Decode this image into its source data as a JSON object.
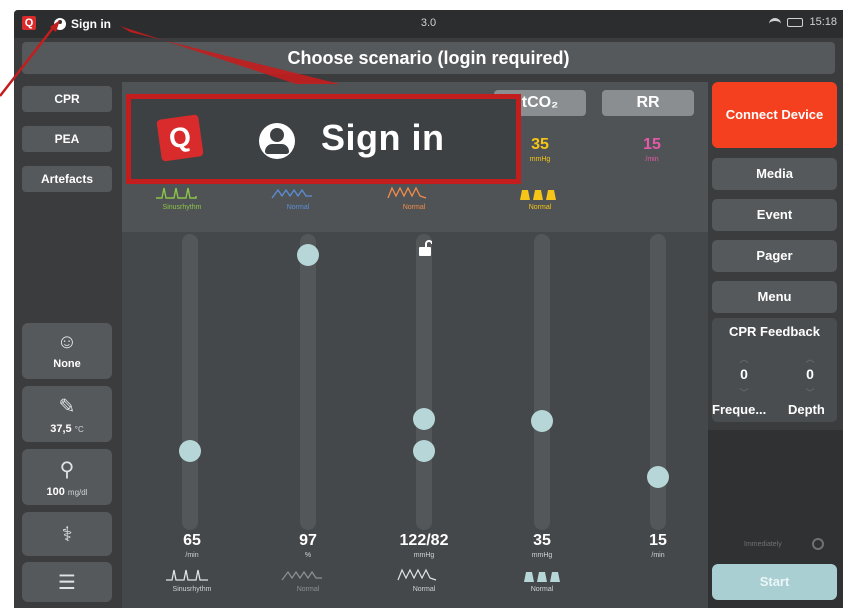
{
  "statusbar": {
    "logo_letter": "Q",
    "signin_label": "Sign in",
    "version": "3.0",
    "time": "15:18"
  },
  "title": "Choose scenario (login required)",
  "sidebar": {
    "buttons": [
      {
        "label": "CPR"
      },
      {
        "label": "PEA"
      },
      {
        "label": "Artefacts"
      }
    ],
    "tiles": [
      {
        "icon": "person-icon",
        "label": "None",
        "sub": ""
      },
      {
        "icon": "thermometer-icon",
        "label": "37,5",
        "sub": "°C"
      },
      {
        "icon": "glucose-icon",
        "label": "100",
        "sub": "mg/dl"
      },
      {
        "icon": "stethoscope-icon",
        "label": "",
        "sub": ""
      },
      {
        "icon": "settings-icon",
        "label": "",
        "sub": ""
      }
    ]
  },
  "header_columns": [
    {
      "label": "",
      "value": "",
      "unit": "",
      "wave_label": "Sinusrhythm",
      "wave_color": "#8bc34a"
    },
    {
      "label": "",
      "value": "",
      "unit": "",
      "wave_label": "Normal",
      "wave_color": "#5b8fd6"
    },
    {
      "label": "",
      "value": "",
      "unit": "",
      "wave_label": "Normal",
      "wave_color": "#f28c4a"
    },
    {
      "label": "tCO₂",
      "value": "35",
      "unit": "mmHg",
      "wave_label": "Normal",
      "wave_color": "#f5c518"
    },
    {
      "label": "RR",
      "value": "15",
      "unit": "/min",
      "wave_label": "",
      "wave_color": "#e35aa8"
    }
  ],
  "sliders": [
    {
      "value": "65",
      "unit": "/min",
      "wave_label": "Sinusrhythm"
    },
    {
      "value": "97",
      "unit": "%",
      "wave_label": "Normal"
    },
    {
      "value": "122/82",
      "unit": "mmHg",
      "wave_label": "Normal"
    },
    {
      "value": "35",
      "unit": "mmHg",
      "wave_label": "Normal"
    },
    {
      "value": "15",
      "unit": "/min",
      "wave_label": ""
    }
  ],
  "right_panel": {
    "connect": "Connect Device",
    "buttons": [
      "Media",
      "Event",
      "Pager",
      "Menu"
    ],
    "cpr_feedback": {
      "title": "CPR Feedback",
      "frequency_value": "0",
      "depth_value": "0",
      "frequency_label": "Freque...",
      "depth_label": "Depth"
    },
    "immediately": "Immediately",
    "start": "Start"
  },
  "callout": {
    "logo_letter": "Q",
    "text": "Sign in"
  },
  "colors": {
    "accent_red": "#c41d1d",
    "connect_orange": "#f4401e",
    "knob": "#b7d6d8"
  }
}
